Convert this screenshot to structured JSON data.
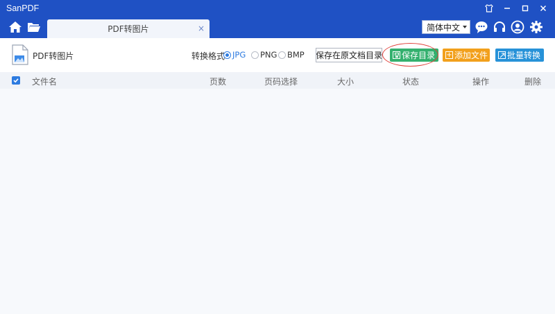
{
  "window": {
    "title": "SanPDF"
  },
  "navbar": {
    "tab_label": "PDF转图片",
    "tab_close": "×",
    "language": "简体中文"
  },
  "toolbar": {
    "page_title": "PDF转图片",
    "format_label": "转换格式",
    "formats": [
      {
        "label": "JPG",
        "checked": true
      },
      {
        "label": "PNG",
        "checked": false
      },
      {
        "label": "BMP",
        "checked": false
      }
    ],
    "save_original_label": "保存在原文档目录",
    "save_dir_label": "保存目录",
    "add_file_label": "添加文件",
    "batch_convert_label": "批量转换"
  },
  "table": {
    "columns": [
      "文件名",
      "页数",
      "页码选择",
      "大小",
      "状态",
      "操作",
      "删除"
    ],
    "select_all_checked": true,
    "rows": []
  },
  "colors": {
    "titlebar": "#1f51c4",
    "accent_blue": "#2d7be0",
    "save_green": "#33b06e",
    "add_orange": "#f2a01c",
    "convert_blue": "#2792d8",
    "highlight_red": "#e0403a"
  },
  "icons": {
    "home": "home-icon",
    "folder": "folder-icon",
    "chat": "chat-icon",
    "headset": "headset-icon",
    "user": "user-icon",
    "settings": "gear-icon"
  }
}
